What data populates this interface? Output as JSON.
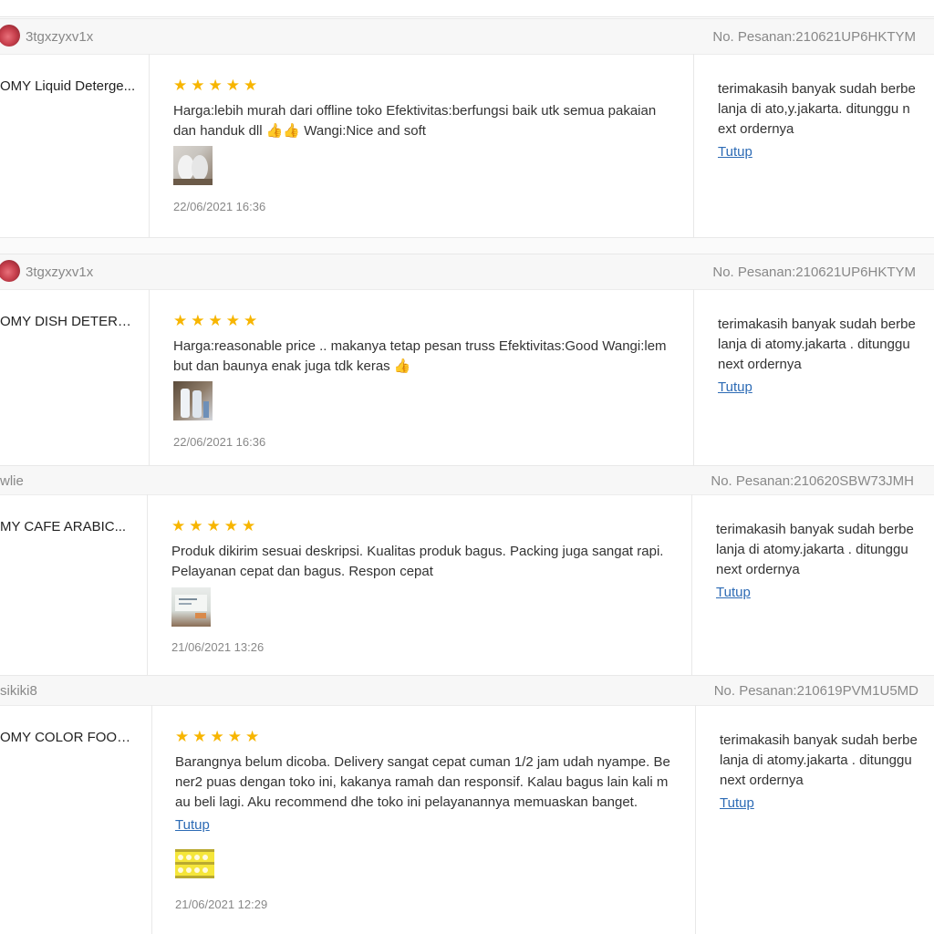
{
  "reviews": [
    {
      "username": "3tgxzyxv1x",
      "order": "No. Pesanan:210621UP6HKTYM",
      "product": "OMY Liquid Deterge...",
      "stars": "★★★★★",
      "review_lines": [
        "Harga:lebih murah dari offline toko Efektivitas:berfungsi baik utk semua pakaian",
        "dan handuk dll 👍👍 Wangi:Nice and soft"
      ],
      "date": "22/06/2021 16:36",
      "reply_lines": [
        "terimakasih banyak sudah berbe",
        "lanja di ato,y.jakarta. ditunggu n",
        "ext ordernya"
      ],
      "reply_close": "Tutup"
    },
    {
      "username": "3tgxzyxv1x",
      "order": "No. Pesanan:210621UP6HKTYM",
      "product": "OMY DISH DETERG...",
      "stars": "★★★★★",
      "review_lines": [
        "Harga:reasonable price .. makanya tetap pesan truss Efektivitas:Good Wangi:lem",
        "but dan baunya enak juga tdk keras 👍"
      ],
      "date": "22/06/2021 16:36",
      "reply_lines": [
        "terimakasih banyak sudah berbe",
        "lanja di atomy.jakarta . ditunggu",
        "next ordernya"
      ],
      "reply_close": "Tutup"
    },
    {
      "username": "wlie",
      "order": "No. Pesanan:210620SBW73JMH",
      "product": "MY CAFE ARABIC...",
      "stars": "★★★★★",
      "review_lines": [
        "Produk dikirim sesuai deskripsi. Kualitas produk bagus. Packing juga sangat rapi.",
        "Pelayanan cepat dan bagus. Respon cepat"
      ],
      "date": "21/06/2021 13:26",
      "reply_lines": [
        "terimakasih banyak sudah berbe",
        "lanja di atomy.jakarta . ditunggu",
        "next ordernya"
      ],
      "reply_close": "Tutup"
    },
    {
      "username": "sikiki8",
      "order": "No. Pesanan:210619PVM1U5MD",
      "product": "OMY COLOR FOOD ...",
      "stars": "★★★★★",
      "review_lines": [
        "Barangnya belum dicoba. Delivery sangat cepat cuman 1/2 jam udah nyampe. Be",
        "ner2 puas dengan toko ini, kakanya ramah dan responsif. Kalau bagus lain kali m",
        "au beli lagi. Aku recommend dhe toko ini pelayanannya memuaskan banget."
      ],
      "review_close": "Tutup",
      "date": "21/06/2021 12:29",
      "reply_lines": [
        "terimakasih banyak sudah berbe",
        "lanja di atomy.jakarta . ditunggu",
        "next ordernya"
      ],
      "reply_close": "Tutup"
    }
  ],
  "colors": {
    "star": "#f7b500",
    "link": "#2d6bb5",
    "header_bg": "#f7f7f7",
    "muted_text": "#888888"
  }
}
